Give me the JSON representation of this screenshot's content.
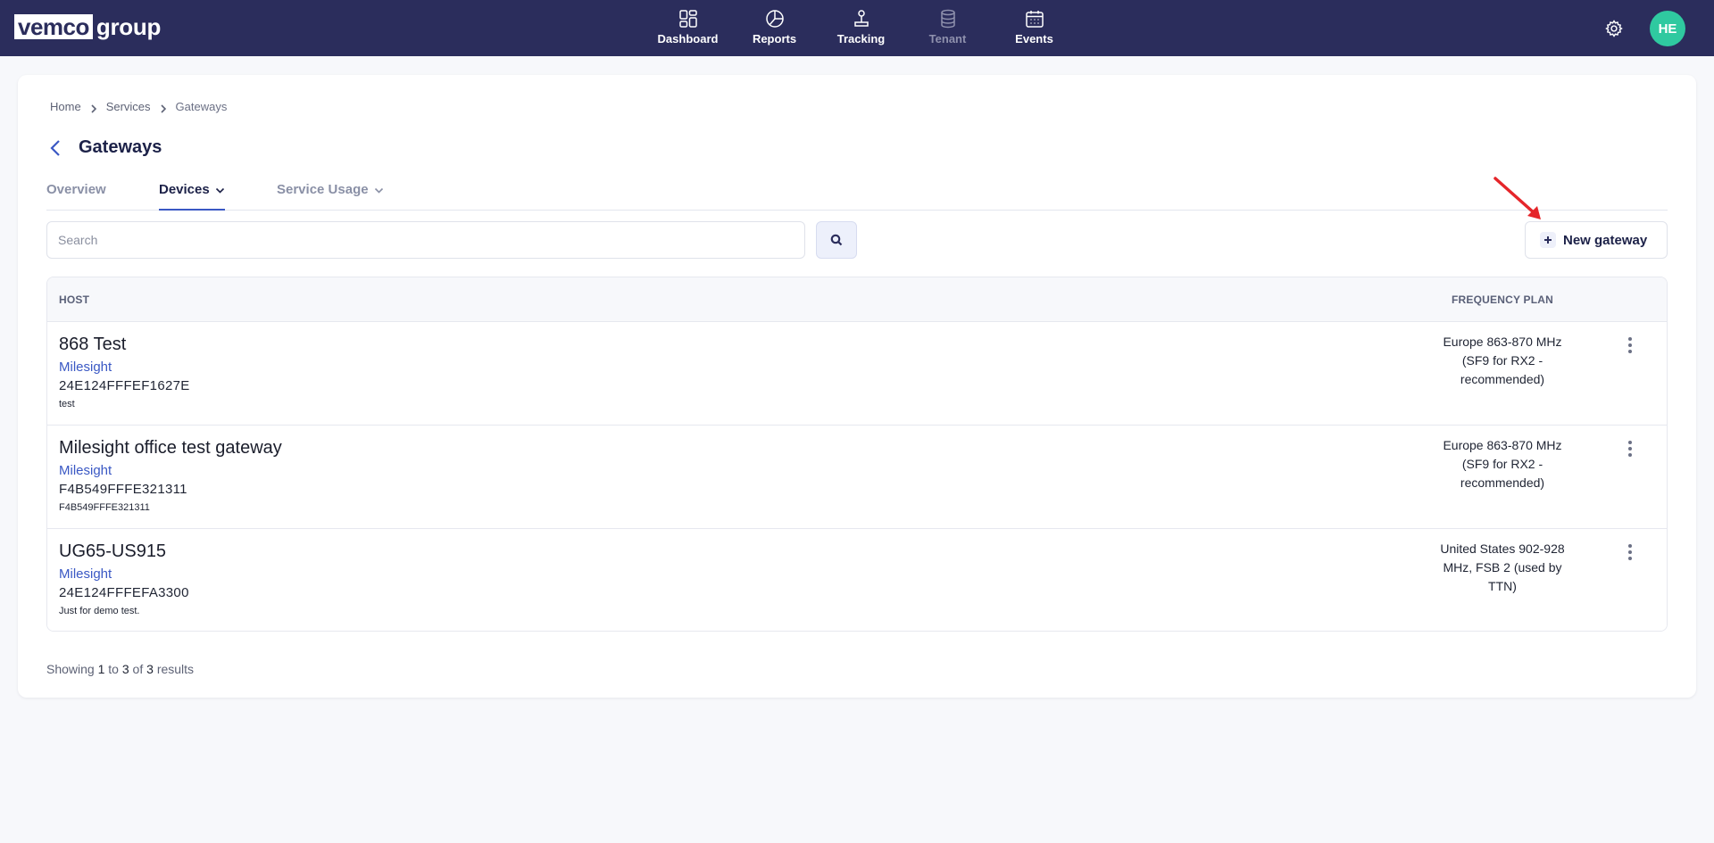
{
  "brand": {
    "logo_box": "vemco",
    "logo_text": "group"
  },
  "nav": [
    {
      "label": "Dashboard",
      "icon": "dashboard-icon",
      "disabled": false
    },
    {
      "label": "Reports",
      "icon": "pie-chart-icon",
      "disabled": false
    },
    {
      "label": "Tracking",
      "icon": "tracking-pin-icon",
      "disabled": false
    },
    {
      "label": "Tenant",
      "icon": "database-icon",
      "disabled": true
    },
    {
      "label": "Events",
      "icon": "calendar-icon",
      "disabled": false
    }
  ],
  "user": {
    "initials": "HE",
    "avatar_color": "#2fc9a0"
  },
  "breadcrumb": [
    "Home",
    "Services",
    "Gateways"
  ],
  "page": {
    "title": "Gateways"
  },
  "tabs": [
    {
      "label": "Overview",
      "active": false,
      "dropdown": false
    },
    {
      "label": "Devices",
      "active": true,
      "dropdown": true
    },
    {
      "label": "Service Usage",
      "active": false,
      "dropdown": true
    }
  ],
  "search": {
    "placeholder": "Search",
    "value": ""
  },
  "new_button": {
    "label": "New gateway"
  },
  "table": {
    "headers": {
      "host": "HOST",
      "frequency": "FREQUENCY PLAN"
    },
    "rows": [
      {
        "name": "868 Test",
        "vendor": "Milesight",
        "eui": "24E124FFFEF1627E",
        "description": "test",
        "frequency_plan": "Europe 863-870 MHz (SF9 for RX2 - recommended)"
      },
      {
        "name": "Milesight office test gateway",
        "vendor": "Milesight",
        "eui": "F4B549FFFE321311",
        "description": "F4B549FFFE321311",
        "frequency_plan": "Europe 863-870 MHz (SF9 for RX2 - recommended)"
      },
      {
        "name": "UG65-US915",
        "vendor": "Milesight",
        "eui": "24E124FFFEFA3300",
        "description": "Just for demo test.",
        "frequency_plan": "United States 902-928 MHz, FSB 2 (used by TTN)"
      }
    ]
  },
  "pagination": {
    "prefix": "Showing",
    "from": "1",
    "to_word": "to",
    "to": "3",
    "of_word": "of",
    "total": "3",
    "suffix": "results"
  },
  "colors": {
    "header_bg": "#2b2d5c",
    "accent": "#3a58c4",
    "annotation_arrow": "#e5252a"
  }
}
